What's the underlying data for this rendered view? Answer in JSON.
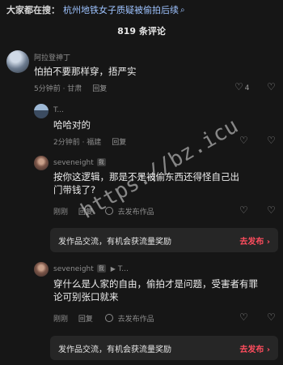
{
  "search": {
    "prefix": "大家都在搜：",
    "query": "杭州地铁女子质疑被偷拍后续",
    "icon": "search-icon"
  },
  "header": {
    "comment_count": "819 条评论"
  },
  "comments": [
    {
      "user": "阿拉登神丁",
      "text": "怕拍不要那样穿，捂严实",
      "time_location": "5分钟前 · 甘肃",
      "reply_label": "回复",
      "likes": "4"
    },
    {
      "user": "T...",
      "text": "哈哈对的",
      "time_location": "2分钟前 · 福建",
      "reply_label": "回复"
    },
    {
      "user": "seveneight",
      "tag": "我",
      "text": "按你这逻辑，那是不是被偷东西还得怪自己出门带钱了?",
      "time_location": "刚刚",
      "reply_label": "回复",
      "publish_label": "去发布作品"
    },
    {
      "user": "seveneight",
      "tag": "我",
      "reply_to": "T...",
      "text": "穿什么是人家的自由，偷拍才是问题，受害者有罪论可别张口就来",
      "time_location": "刚刚",
      "reply_label": "回复",
      "publish_label": "去发布作品"
    }
  ],
  "promo": {
    "text": "发作品交流，有机会获流量奖励",
    "action": "去发布",
    "arrow": "›"
  },
  "watermark": "https://bz.icu"
}
